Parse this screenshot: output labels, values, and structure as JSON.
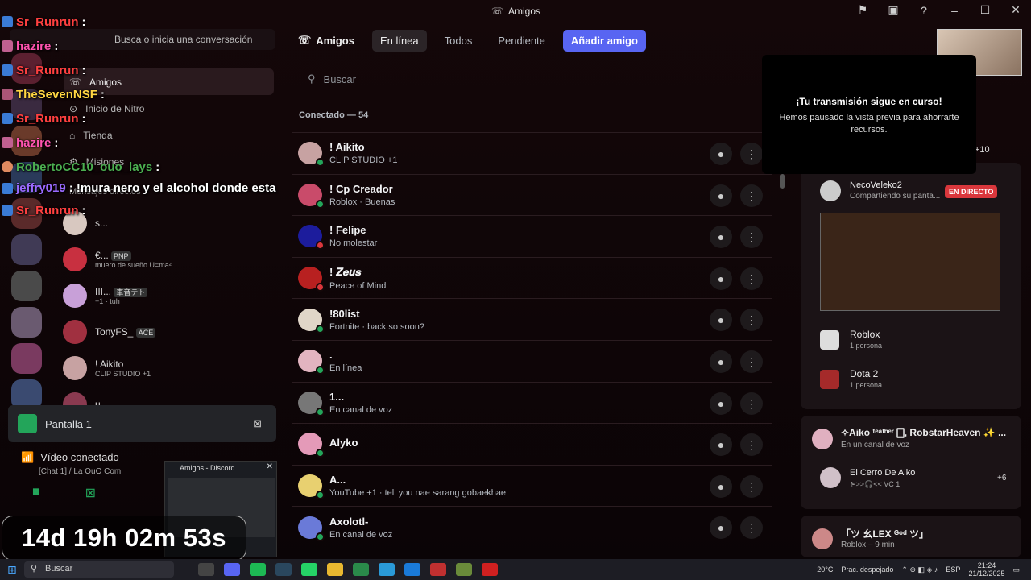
{
  "window": {
    "title": "Amigos"
  },
  "sidebar": {
    "search_placeholder": "Busca o inicia una conversación",
    "nav": [
      {
        "label": "Amigos"
      },
      {
        "label": "Inicio de Nitro"
      },
      {
        "label": "Tienda"
      },
      {
        "label": "Misiones"
      }
    ],
    "dm_header": "Mensajes directos",
    "dms": [
      {
        "name": "s...",
        "status": ""
      },
      {
        "name": "€...",
        "badge": "PNP",
        "status": "muero de sueño U=ma²"
      },
      {
        "name": "III...",
        "badge": "車音テト",
        "status": "+1 · tuh"
      },
      {
        "name": "TonyFS_",
        "badge": "ACE",
        "status": ""
      },
      {
        "name": "! Aikito",
        "badge": "",
        "status": "CLIP STUDIO +1"
      },
      {
        "name": "u...",
        "badge": "",
        "status": ""
      }
    ]
  },
  "chat": [
    {
      "user": "Sr_Runrun",
      "msg": ":",
      "color": "red"
    },
    {
      "user": "hazire",
      "msg": ":",
      "color": "pink"
    },
    {
      "user": "Sr_Runrun",
      "msg": ":",
      "color": "red"
    },
    {
      "user": "TheSevenNSF",
      "msg": ":",
      "color": "yel"
    },
    {
      "user": "Sr_Runrun",
      "msg": ":",
      "color": "red"
    },
    {
      "user": "hazire",
      "msg": ":",
      "color": "pink"
    },
    {
      "user": "RobertoCC10_ouo_lays",
      "msg": ":",
      "color": "grn"
    },
    {
      "user": "jeffry019",
      "msg": ": !mura nero y el alcohol donde esta",
      "color": "pur"
    },
    {
      "user": "Sr_Runrun",
      "msg": ":",
      "color": "red"
    }
  ],
  "voice": {
    "screen_label": "Pantalla 1",
    "connected": "Vídeo conectado",
    "channel": "[Chat 1] / La OuO Com",
    "mini_title": "Amigos - Discord"
  },
  "timer": "14d 19h 02m 53s",
  "tabs": {
    "title": "Amigos",
    "online": "En línea",
    "all": "Todos",
    "pending": "Pendiente",
    "add": "Añadir amigo"
  },
  "search_placeholder": "Buscar",
  "online_count": "Conectado — 54",
  "friends": [
    {
      "name": "! Aikito",
      "status": "CLIP STUDIO +1",
      "color": "#c7a2a2"
    },
    {
      "name": "! Cp Creador",
      "status": "Roblox · Buenas",
      "color": "#c94b6a"
    },
    {
      "name": "! Felipe",
      "status": "No molestar",
      "color": "#1c1c9c"
    },
    {
      "name": "! 𝒁𝒆𝒖𝒔",
      "status": "Peace of Mind",
      "color": "#b82020"
    },
    {
      "name": "!80list",
      "status": "Fortnite · back so soon?",
      "color": "#e0d6c8"
    },
    {
      "name": ".",
      "status": "En línea",
      "color": "#e2b4c0"
    },
    {
      "name": "1...",
      "status": "En canal de voz",
      "color": "#777"
    },
    {
      "name": "Alyko",
      "status": "",
      "color": "#e49ab8"
    },
    {
      "name": "A...",
      "status": "YouTube +1 · tell you nae sarang gobaekhae",
      "color": "#e8d070"
    },
    {
      "name": "Axolotl-",
      "status": "En canal de voz",
      "color": "#6a7ad8"
    }
  ],
  "notice": {
    "title": "¡Tu transmisión sigue en curso!",
    "body": "Hemos pausado la vista previa para ahorrarte recursos."
  },
  "activity": {
    "plus": "+10",
    "streamer": "NecoVeleko2",
    "streamer_status": "Compartiendo su panta...",
    "live": "EN DIRECTO",
    "games": [
      {
        "name": "Roblox",
        "sub": "1 persona"
      },
      {
        "name": "Dota 2",
        "sub": "1 persona"
      }
    ],
    "voice_title": "✧Aiko ᶠᵉᵃᵗʰᵉʳ 🀆, RobstarHeaven ✨ ...",
    "voice_sub": "En un canal de voz",
    "voice_channel": "El Cerro De Aiko",
    "voice_channel_sub": "⊱>>🎧<< VC 1",
    "voice_plus": "+6",
    "last_title": "「ツ 幺LEX ᴳᵒᵈ ツ」",
    "last_sub": "Roblox – 9 min"
  },
  "taskbar": {
    "search": "Buscar",
    "weather": "20°C",
    "weather_desc": "Prac. despejado",
    "lang": "ESP",
    "time": "21:24",
    "date": "21/12/2025"
  }
}
